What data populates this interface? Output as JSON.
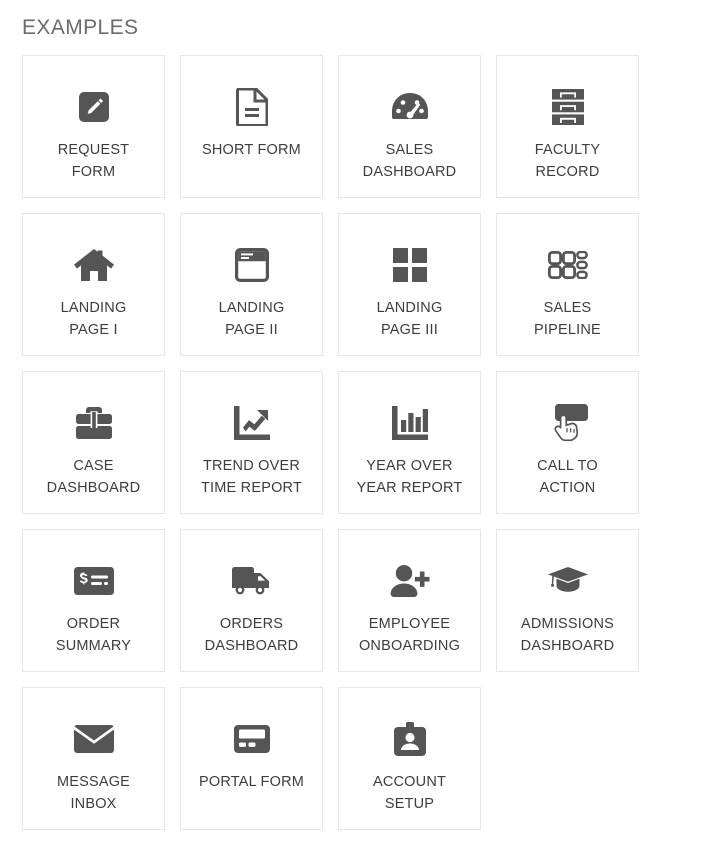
{
  "section": {
    "title": "EXAMPLES"
  },
  "colors": {
    "icon": "#555555",
    "card_border": "#e6e6e6",
    "label_text": "#3d3d3d",
    "title_text": "#6b6b6b",
    "background": "#ffffff"
  },
  "cards": [
    {
      "label": "REQUEST\nFORM",
      "icon": "pencil-square-icon"
    },
    {
      "label": "SHORT FORM",
      "icon": "document-lines-icon"
    },
    {
      "label": "SALES\nDASHBOARD",
      "icon": "gauge-icon"
    },
    {
      "label": "FACULTY\nRECORD",
      "icon": "filing-cabinet-icon"
    },
    {
      "label": "LANDING\nPAGE I",
      "icon": "home-icon"
    },
    {
      "label": "LANDING\nPAGE II",
      "icon": "browser-window-icon"
    },
    {
      "label": "LANDING\nPAGE III",
      "icon": "four-squares-grid-icon"
    },
    {
      "label": "SALES\nPIPELINE",
      "icon": "pipeline-grid-icon"
    },
    {
      "label": "CASE\nDASHBOARD",
      "icon": "briefcase-icon"
    },
    {
      "label": "TREND OVER\nTIME REPORT",
      "icon": "line-chart-arrow-icon"
    },
    {
      "label": "YEAR OVER\nYEAR REPORT",
      "icon": "bar-chart-icon"
    },
    {
      "label": "CALL TO\nACTION",
      "icon": "button-click-hand-icon"
    },
    {
      "label": "ORDER\nSUMMARY",
      "icon": "receipt-dollar-icon"
    },
    {
      "label": "ORDERS\nDASHBOARD",
      "icon": "delivery-truck-icon"
    },
    {
      "label": "EMPLOYEE\nONBOARDING",
      "icon": "user-plus-icon"
    },
    {
      "label": "ADMISSIONS\nDASHBOARD",
      "icon": "graduation-cap-icon"
    },
    {
      "label": "MESSAGE\nINBOX",
      "icon": "envelope-icon"
    },
    {
      "label": "PORTAL FORM",
      "icon": "card-form-icon"
    },
    {
      "label": "ACCOUNT\nSETUP",
      "icon": "id-badge-icon"
    }
  ]
}
